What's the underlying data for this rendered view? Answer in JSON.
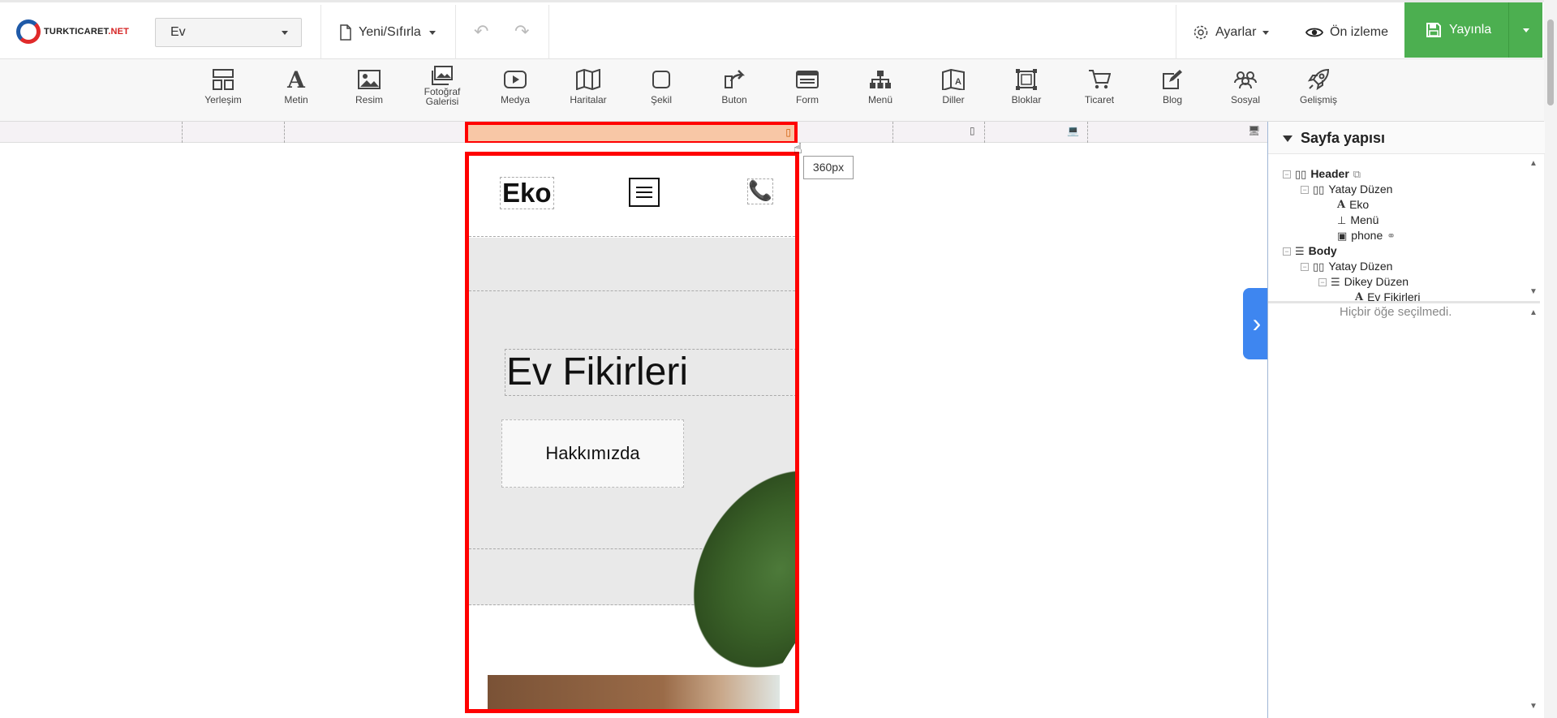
{
  "app": {
    "logo_text": "TURKTICARET",
    "logo_suffix": ".NET",
    "page_select": "Ev",
    "new_reset": "Yeni/Sıfırla",
    "settings": "Ayarlar",
    "preview": "Ön izleme",
    "publish": "Yayınla"
  },
  "toolbar": {
    "items": [
      {
        "label": "Yerleşim",
        "icon": "layout-icon"
      },
      {
        "label": "Metin",
        "icon": "text-icon"
      },
      {
        "label": "Resim",
        "icon": "image-icon"
      },
      {
        "label": "Fotoğraf Galerisi",
        "icon": "gallery-icon"
      },
      {
        "label": "Medya",
        "icon": "media-icon"
      },
      {
        "label": "Haritalar",
        "icon": "map-icon"
      },
      {
        "label": "Şekil",
        "icon": "shape-icon"
      },
      {
        "label": "Buton",
        "icon": "button-icon"
      },
      {
        "label": "Form",
        "icon": "form-icon"
      },
      {
        "label": "Menü",
        "icon": "menu-icon"
      },
      {
        "label": "Diller",
        "icon": "languages-icon"
      },
      {
        "label": "Bloklar",
        "icon": "blocks-icon"
      },
      {
        "label": "Ticaret",
        "icon": "cart-icon"
      },
      {
        "label": "Blog",
        "icon": "blog-icon"
      },
      {
        "label": "Sosyal",
        "icon": "social-icon"
      },
      {
        "label": "Gelişmiş",
        "icon": "rocket-icon"
      }
    ]
  },
  "canvas": {
    "width_tooltip": "360px",
    "site_logo": "Eko",
    "hero_title": "Ev Fikirleri",
    "hero_button": "Hakkımızda"
  },
  "panel": {
    "title": "Sayfa yapısı",
    "tree": [
      {
        "label": "Header",
        "bold": true
      },
      {
        "label": "Yatay Düzen"
      },
      {
        "label": "Eko"
      },
      {
        "label": "Menü"
      },
      {
        "label": "phone"
      },
      {
        "label": "Body",
        "bold": true
      },
      {
        "label": "Yatay Düzen"
      },
      {
        "label": "Dikey Düzen"
      },
      {
        "label": "Ev Fikirleri"
      }
    ],
    "empty_selection": "Hiçbir öğe seçilmedi."
  },
  "colors": {
    "publish": "#4caf50",
    "accent": "#3e86f0",
    "selection": "#ff0000"
  }
}
